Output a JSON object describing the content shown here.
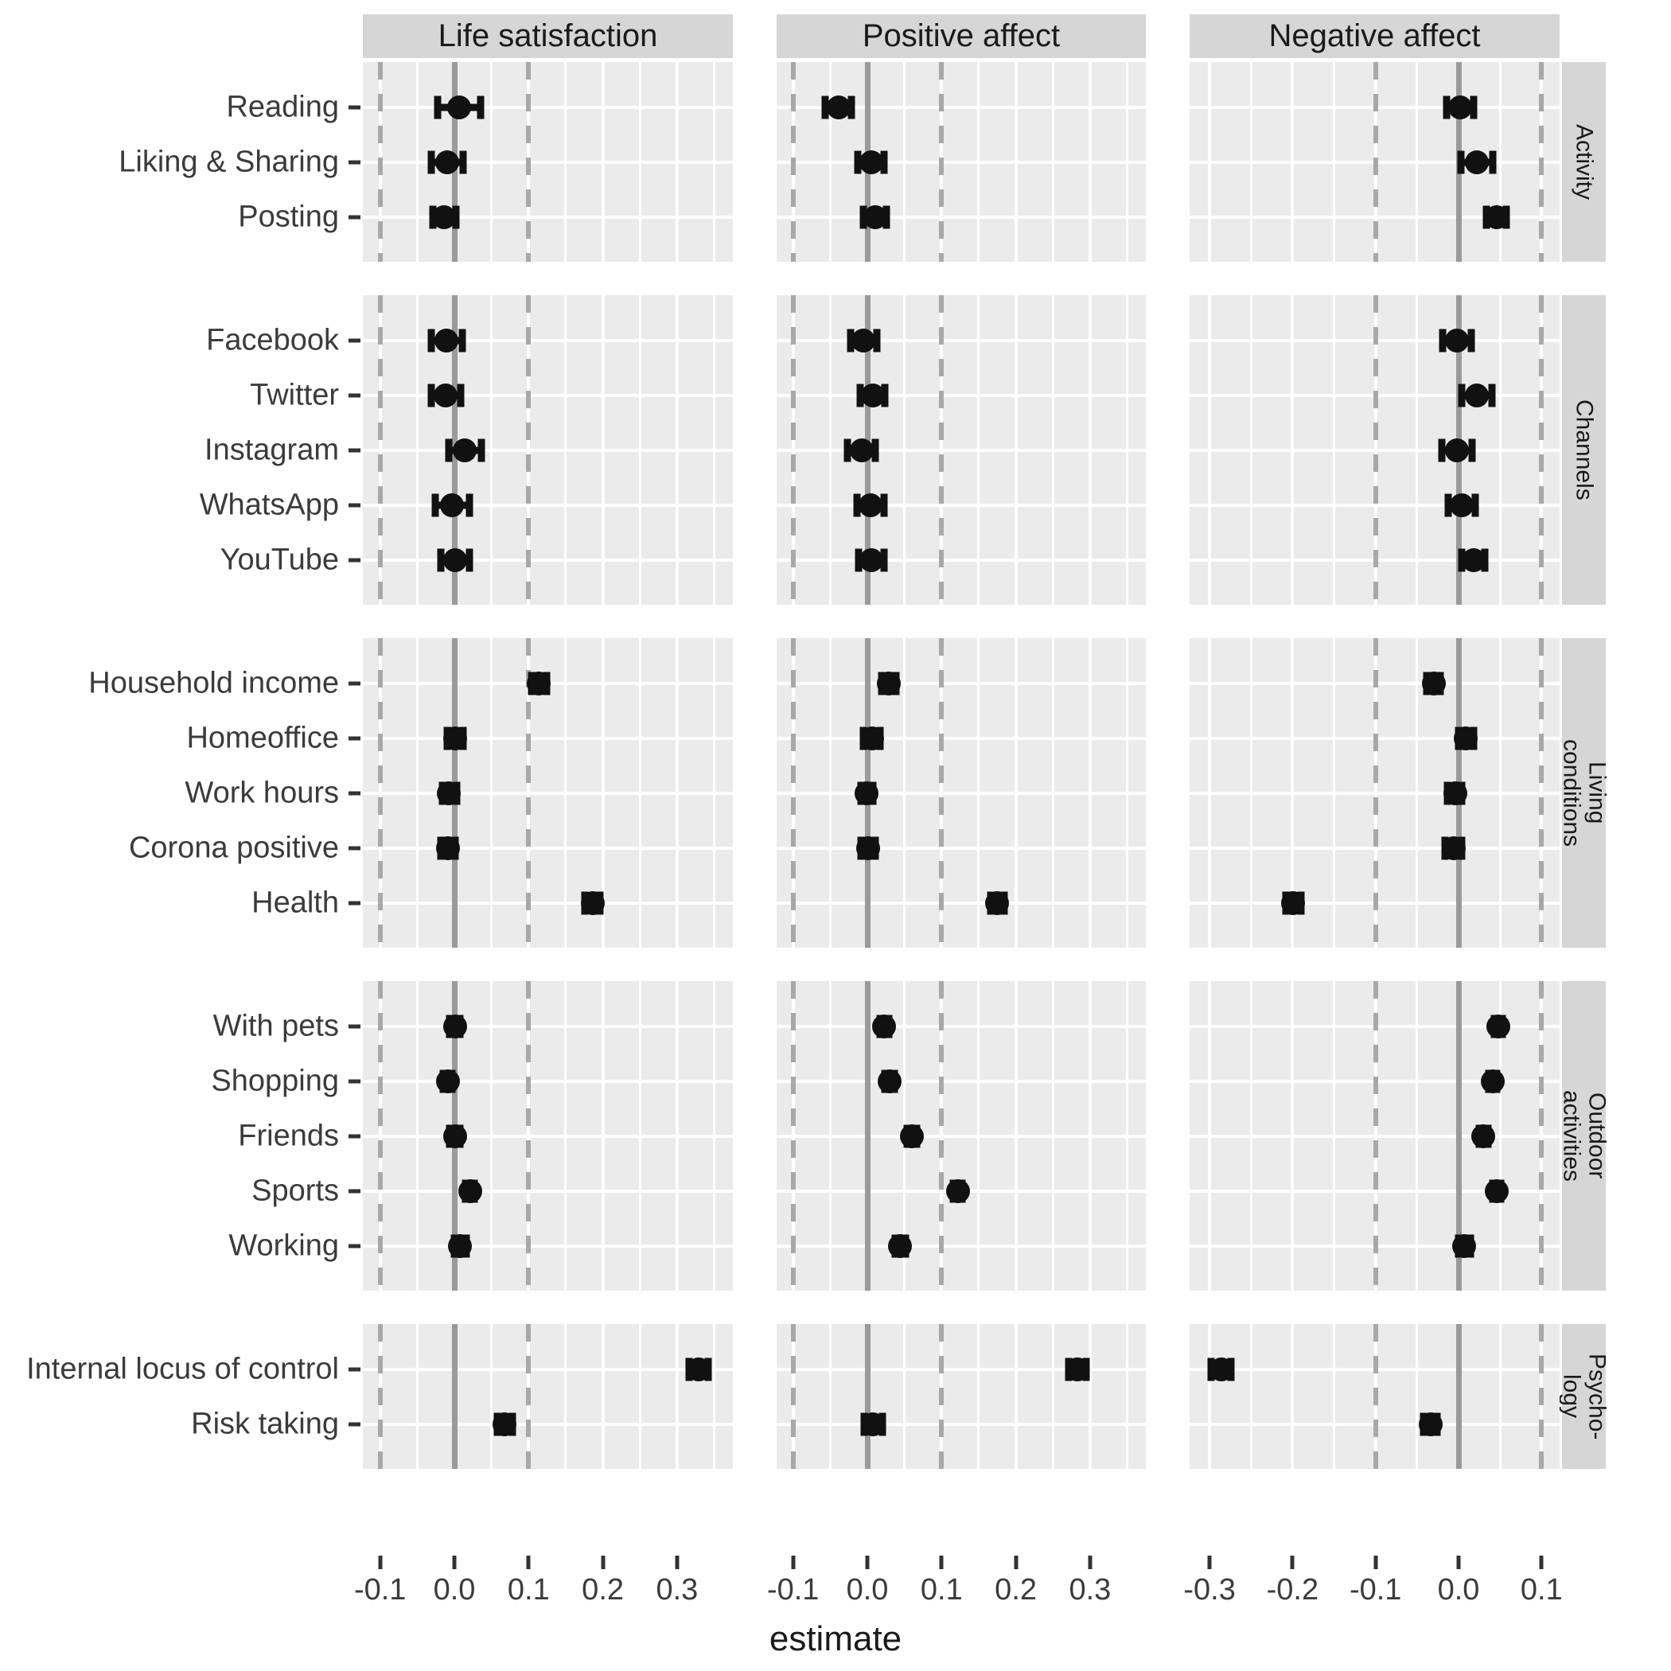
{
  "figure": {
    "x_axis_title": "estimate",
    "column_titles": [
      "Life satisfaction",
      "Positive affect",
      "Negative affect"
    ],
    "row_strip_labels": [
      "Activity",
      "Channels",
      "Living\nconditions",
      "Outdoor\nactivities",
      "Psycho-\nlogy"
    ],
    "reference_lines": {
      "solid": 0.0,
      "dashed": [
        -0.1,
        0.1
      ]
    },
    "colors": {
      "panel_fill": "#ebebeb",
      "strip_fill": "#d6d6d6",
      "gridline": "#ffffff",
      "reference_solid": "#9a9a9a",
      "reference_dashed": "#a8a8a8",
      "point": "#111111",
      "text": "#3b3b3b",
      "background": "#ffffff"
    }
  },
  "chart_data": {
    "type": "scatter",
    "title": "",
    "xlabel": "estimate",
    "ylabel": "",
    "grid": true,
    "legend": null,
    "facet_columns": [
      "Life satisfaction",
      "Positive affect",
      "Negative affect"
    ],
    "facet_rows": [
      "Activity",
      "Channels",
      "Living conditions",
      "Outdoor activities",
      "Psychology"
    ],
    "axis_ranges": {
      "Life satisfaction": {
        "xlim": [
          -0.123,
          0.375
        ],
        "ticks": [
          -0.1,
          0.0,
          0.1,
          0.2,
          0.3
        ],
        "tick_labels": [
          "-0.1",
          "0.0",
          "0.1",
          "0.2",
          "0.3"
        ]
      },
      "Positive affect": {
        "xlim": [
          -0.123,
          0.375
        ],
        "ticks": [
          -0.1,
          0.0,
          0.1,
          0.2,
          0.3
        ],
        "tick_labels": [
          "-0.1",
          "0.0",
          "0.1",
          "0.2",
          "0.3"
        ]
      },
      "Negative affect": {
        "xlim": [
          -0.336,
          0.147
        ],
        "ticks": [
          -0.3,
          -0.2,
          -0.1,
          0.0,
          0.1
        ],
        "tick_labels": [
          "-0.3",
          "-0.2",
          "-0.1",
          "0.0",
          "0.1"
        ]
      }
    },
    "groups": [
      {
        "strip": "Activity",
        "rows": [
          {
            "label": "Reading",
            "Life satisfaction": {
              "estimate": 0.006,
              "lower": -0.023,
              "upper": 0.035
            },
            "Positive affect": {
              "estimate": -0.039,
              "lower": -0.057,
              "upper": -0.021
            },
            "Negative affect": {
              "estimate": 0.002,
              "lower": -0.014,
              "upper": 0.018
            }
          },
          {
            "label": "Liking & Sharing",
            "Life satisfaction": {
              "estimate": -0.01,
              "lower": -0.031,
              "upper": 0.012
            },
            "Positive affect": {
              "estimate": 0.005,
              "lower": -0.013,
              "upper": 0.023
            },
            "Negative affect": {
              "estimate": 0.022,
              "lower": 0.003,
              "upper": 0.041
            }
          },
          {
            "label": "Posting",
            "Life satisfaction": {
              "estimate": -0.014,
              "lower": -0.029,
              "upper": 0.002
            },
            "Positive affect": {
              "estimate": 0.011,
              "lower": -0.005,
              "upper": 0.026
            },
            "Negative affect": {
              "estimate": 0.046,
              "lower": 0.034,
              "upper": 0.058
            }
          }
        ]
      },
      {
        "strip": "Channels",
        "rows": [
          {
            "label": "Facebook",
            "Life satisfaction": {
              "estimate": -0.011,
              "lower": -0.031,
              "upper": 0.011
            },
            "Positive affect": {
              "estimate": -0.005,
              "lower": -0.023,
              "upper": 0.013
            },
            "Negative affect": {
              "estimate": -0.002,
              "lower": -0.019,
              "upper": 0.015
            }
          },
          {
            "label": "Twitter",
            "Life satisfaction": {
              "estimate": -0.012,
              "lower": -0.031,
              "upper": 0.009
            },
            "Positive affect": {
              "estimate": 0.007,
              "lower": -0.01,
              "upper": 0.024
            },
            "Negative affect": {
              "estimate": 0.022,
              "lower": 0.004,
              "upper": 0.04
            }
          },
          {
            "label": "Instagram",
            "Life satisfaction": {
              "estimate": 0.014,
              "lower": -0.008,
              "upper": 0.036
            },
            "Positive affect": {
              "estimate": -0.008,
              "lower": -0.027,
              "upper": 0.011
            },
            "Negative affect": {
              "estimate": -0.002,
              "lower": -0.02,
              "upper": 0.016
            }
          },
          {
            "label": "WhatsApp",
            "Life satisfaction": {
              "estimate": -0.003,
              "lower": -0.026,
              "upper": 0.02
            },
            "Positive affect": {
              "estimate": 0.004,
              "lower": -0.014,
              "upper": 0.022
            },
            "Negative affect": {
              "estimate": 0.004,
              "lower": -0.012,
              "upper": 0.02
            }
          },
          {
            "label": "YouTube",
            "Life satisfaction": {
              "estimate": 0.001,
              "lower": -0.018,
              "upper": 0.02
            },
            "Positive affect": {
              "estimate": 0.005,
              "lower": -0.012,
              "upper": 0.022
            },
            "Negative affect": {
              "estimate": 0.018,
              "lower": 0.004,
              "upper": 0.032
            }
          }
        ]
      },
      {
        "strip": "Living conditions",
        "rows": [
          {
            "label": "Household income",
            "Life satisfaction": {
              "estimate": 0.114,
              "lower": 0.104,
              "upper": 0.124
            },
            "Positive affect": {
              "estimate": 0.029,
              "lower": 0.019,
              "upper": 0.039
            },
            "Negative affect": {
              "estimate": -0.03,
              "lower": -0.038,
              "upper": -0.022
            }
          },
          {
            "label": "Homeoffice",
            "Life satisfaction": {
              "estimate": 0.001,
              "lower": -0.01,
              "upper": 0.012
            },
            "Positive affect": {
              "estimate": 0.006,
              "lower": -0.005,
              "upper": 0.017
            },
            "Negative affect": {
              "estimate": 0.009,
              "lower": 0.0,
              "upper": 0.018
            }
          },
          {
            "label": "Work hours",
            "Life satisfaction": {
              "estimate": -0.007,
              "lower": -0.016,
              "upper": 0.003
            },
            "Positive affect": {
              "estimate": -0.001,
              "lower": -0.009,
              "upper": 0.007
            },
            "Negative affect": {
              "estimate": -0.004,
              "lower": -0.013,
              "upper": 0.004
            }
          },
          {
            "label": "Corona positive",
            "Life satisfaction": {
              "estimate": -0.009,
              "lower": -0.018,
              "upper": 0.001
            },
            "Positive affect": {
              "estimate": 0.001,
              "lower": -0.009,
              "upper": 0.011
            },
            "Negative affect": {
              "estimate": -0.006,
              "lower": -0.016,
              "upper": 0.004
            }
          },
          {
            "label": "Health",
            "Life satisfaction": {
              "estimate": 0.186,
              "lower": 0.176,
              "upper": 0.196
            },
            "Positive affect": {
              "estimate": 0.175,
              "lower": 0.166,
              "upper": 0.184
            },
            "Negative affect": {
              "estimate": -0.199,
              "lower": -0.208,
              "upper": -0.19
            }
          }
        ]
      },
      {
        "strip": "Outdoor activities",
        "rows": [
          {
            "label": "With pets",
            "Life satisfaction": {
              "estimate": 0.001,
              "lower": -0.006,
              "upper": 0.008
            },
            "Positive affect": {
              "estimate": 0.023,
              "lower": 0.017,
              "upper": 0.029
            },
            "Negative affect": {
              "estimate": 0.048,
              "lower": 0.043,
              "upper": 0.053
            }
          },
          {
            "label": "Shopping",
            "Life satisfaction": {
              "estimate": -0.009,
              "lower": -0.015,
              "upper": -0.003
            },
            "Positive affect": {
              "estimate": 0.03,
              "lower": 0.024,
              "upper": 0.036
            },
            "Negative affect": {
              "estimate": 0.041,
              "lower": 0.036,
              "upper": 0.046
            }
          },
          {
            "label": "Friends",
            "Life satisfaction": {
              "estimate": 0.001,
              "lower": -0.006,
              "upper": 0.008
            },
            "Positive affect": {
              "estimate": 0.06,
              "lower": 0.054,
              "upper": 0.066
            },
            "Negative affect": {
              "estimate": 0.03,
              "lower": 0.025,
              "upper": 0.035
            }
          },
          {
            "label": "Sports",
            "Life satisfaction": {
              "estimate": 0.021,
              "lower": 0.015,
              "upper": 0.027
            },
            "Positive affect": {
              "estimate": 0.122,
              "lower": 0.116,
              "upper": 0.128
            },
            "Negative affect": {
              "estimate": 0.046,
              "lower": 0.041,
              "upper": 0.051
            }
          },
          {
            "label": "Working",
            "Life satisfaction": {
              "estimate": 0.008,
              "lower": 0.0,
              "upper": 0.016
            },
            "Positive affect": {
              "estimate": 0.044,
              "lower": 0.037,
              "upper": 0.051
            },
            "Negative affect": {
              "estimate": 0.007,
              "lower": 0.0,
              "upper": 0.014
            }
          }
        ]
      },
      {
        "strip": "Psychology",
        "rows": [
          {
            "label": "Internal locus of control",
            "Life satisfaction": {
              "estimate": 0.329,
              "lower": 0.316,
              "upper": 0.342
            },
            "Positive affect": {
              "estimate": 0.283,
              "lower": 0.271,
              "upper": 0.295
            },
            "Negative affect": {
              "estimate": -0.286,
              "lower": -0.298,
              "upper": -0.274
            }
          },
          {
            "label": "Risk taking",
            "Life satisfaction": {
              "estimate": 0.068,
              "lower": 0.058,
              "upper": 0.078
            },
            "Positive affect": {
              "estimate": 0.008,
              "lower": -0.004,
              "upper": 0.02
            },
            "Negative affect": {
              "estimate": -0.034,
              "lower": -0.042,
              "upper": -0.026
            }
          }
        ]
      }
    ]
  }
}
